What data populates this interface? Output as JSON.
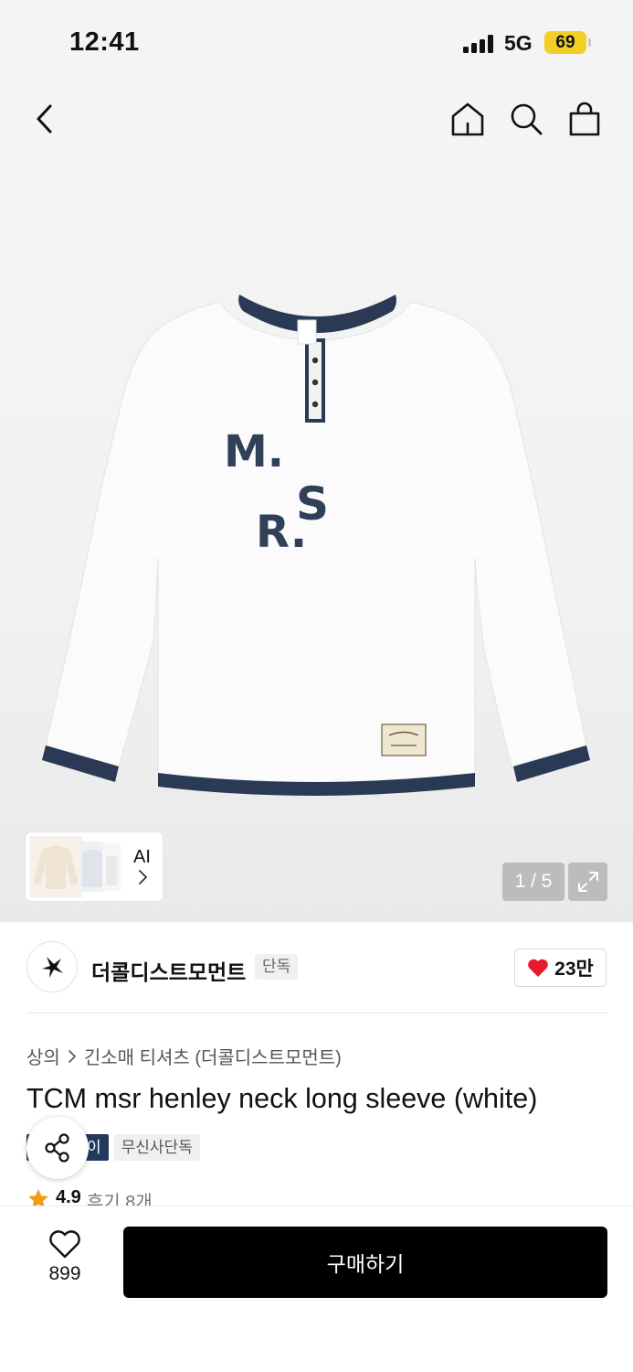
{
  "status_bar": {
    "time": "12:41",
    "network": "5G",
    "battery": "69"
  },
  "nav": {
    "back_icon": "chevron-left-icon",
    "home_icon": "home-icon",
    "search_icon": "search-icon",
    "bag_icon": "shopping-bag-icon"
  },
  "product_image": {
    "print_letters": [
      "M.",
      "S",
      "R."
    ],
    "thumbnail_label": "AI",
    "pager": "1 / 5"
  },
  "brand": {
    "name": "더콜디스트모먼트",
    "badge": "단독",
    "likes": "23만",
    "like_color": "#e8192c"
  },
  "breadcrumb": {
    "category": "상의",
    "sub": "긴소매 티셔츠 (더콜디스트모먼트)"
  },
  "product": {
    "title": "TCM msr henley neck long sleeve (white)",
    "tags": [
      "이",
      "무신사단독"
    ],
    "rating": "4.9",
    "reviews": "후기 8개"
  },
  "bottom": {
    "wish_count": "899",
    "buy_label": "구매하기"
  },
  "colors": {
    "navy": "#233a5e",
    "rating_star": "#f39c12",
    "battery": "#f2cf24"
  }
}
